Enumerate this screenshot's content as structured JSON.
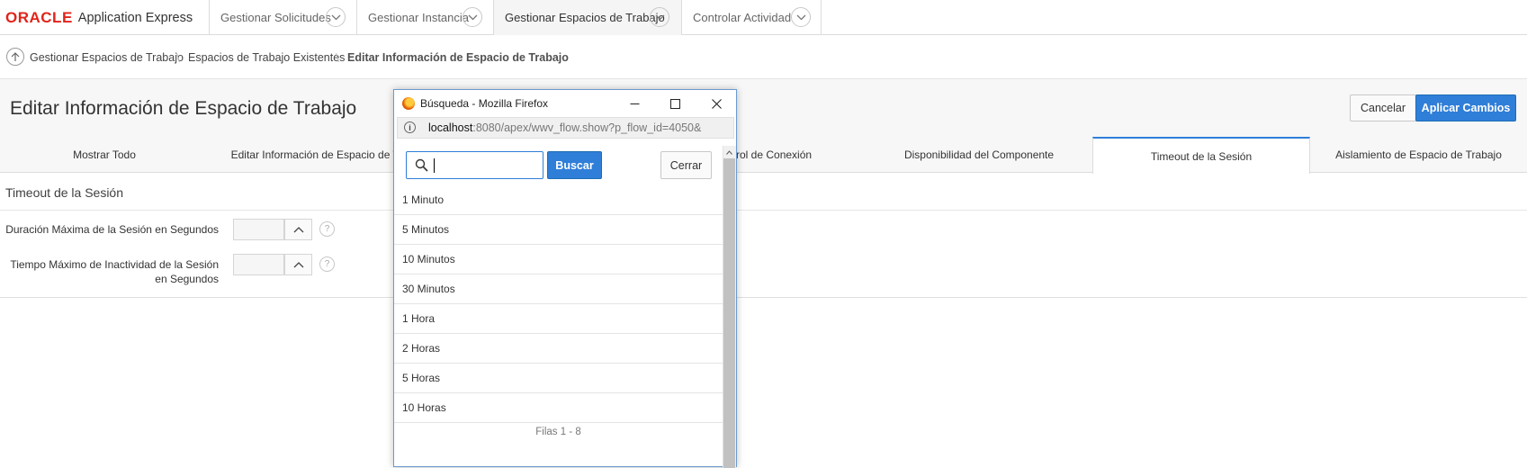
{
  "topnav": {
    "logo_oracle": "ORACLE",
    "logo_product": "Application Express",
    "tabs": [
      {
        "label": "Gestionar Solicitudes"
      },
      {
        "label": "Gestionar Instancia"
      },
      {
        "label": "Gestionar Espacios de Trabajo"
      },
      {
        "label": "Controlar Actividad"
      }
    ],
    "active_tab": "Gestionar Espacios de Trabajo"
  },
  "breadcrumb": {
    "items": [
      "Gestionar Espacios de Trabajo",
      "Espacios de Trabajo Existentes",
      "Editar Información de Espacio de Trabajo"
    ]
  },
  "header": {
    "title": "Editar Información de Espacio de Trabajo",
    "cancel_label": "Cancelar",
    "apply_label": "Aplicar Cambios"
  },
  "region_tabs": {
    "visible_labels": [
      "Mostrar Todo",
      "Editar Información de Espacio de Tr",
      "rol de Conexión",
      "Disponibilidad del Componente",
      "Timeout de la Sesión",
      "Aislamiento de Espacio de Trabajo"
    ],
    "active": "Timeout de la Sesión"
  },
  "region": {
    "title": "Timeout de la Sesión",
    "fields": [
      {
        "label": "Duración Máxima de la Sesión en Segundos",
        "value": ""
      },
      {
        "label_line1": "Tiempo Máximo de Inactividad de la Sesión",
        "label_line2": "en Segundos",
        "value": ""
      }
    ],
    "help_glyph": "?"
  },
  "popup": {
    "window_title": "Búsqueda - Mozilla Firefox",
    "url_host": "localhost",
    "url_rest": ":8080/apex/wwv_flow.show?p_flow_id=4050&",
    "search_value": "",
    "search_button": "Buscar",
    "close_button": "Cerrar",
    "items": [
      "1 Minuto",
      "5 Minutos",
      "10 Minutos",
      "30 Minutos",
      "1 Hora",
      "2 Horas",
      "5 Horas",
      "10 Horas"
    ],
    "footer": "Filas 1 - 8"
  },
  "colors": {
    "accent": "#2f7ed8",
    "oracle_red": "#e2231a"
  }
}
